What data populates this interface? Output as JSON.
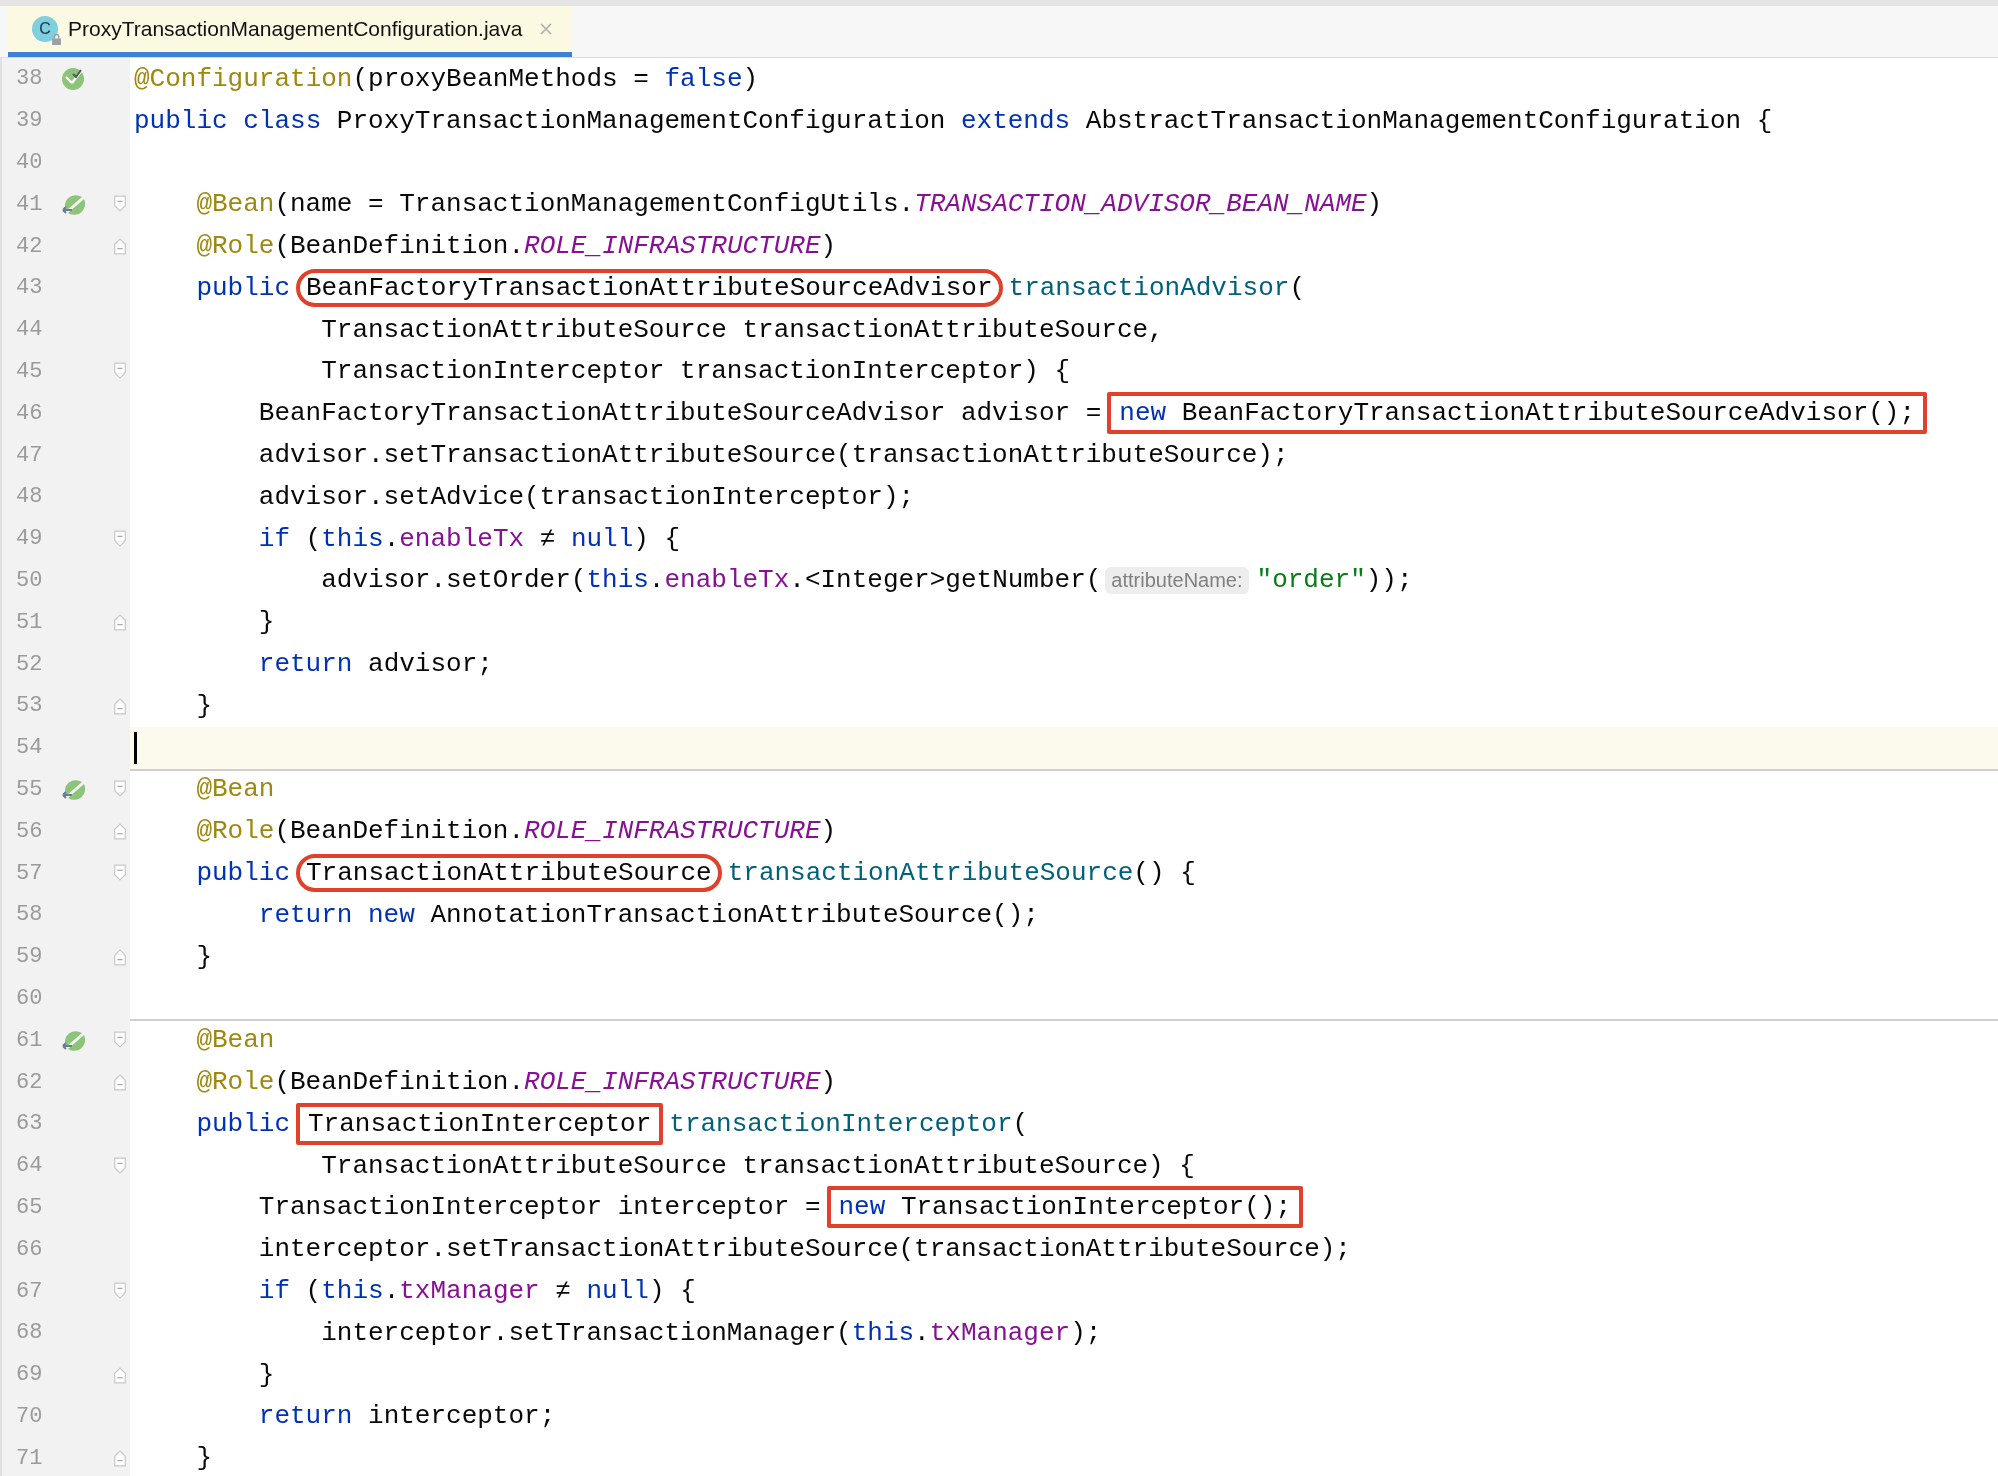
{
  "tab": {
    "icon_letter": "C",
    "title": "ProxyTransactionManagementConfiguration.java",
    "selected": true
  },
  "lines": [
    {
      "number": "38",
      "kind": "code",
      "gutter_icon": {
        "kind": "config"
      },
      "tokens": [
        {
          "text": "@Configuration",
          "kind": "annotation"
        },
        {
          "text": "(proxyBeanMethods = ",
          "kind": "plain"
        },
        {
          "text": "false",
          "kind": "keyword"
        },
        {
          "text": ")",
          "kind": "plain"
        }
      ]
    },
    {
      "number": "39",
      "kind": "code",
      "tokens": [
        {
          "text": "public class",
          "kind": "keyword"
        },
        {
          "text": " ProxyTransactionManagementConfiguration ",
          "kind": "plain"
        },
        {
          "text": "extends",
          "kind": "keyword"
        },
        {
          "text": " AbstractTransactionManagementConfiguration {",
          "kind": "plain"
        }
      ],
      "children": [
        {
          "number": "40",
          "kind": "blank"
        },
        {
          "number": "41",
          "kind": "code",
          "gutter_icon": {
            "kind": "bean"
          },
          "fold_marker": {
            "kind": "start"
          },
          "tokens": [
            {
              "text": "@Bean",
              "kind": "annotation"
            },
            {
              "text": "(name = TransactionManagementConfigUtils.",
              "kind": "plain"
            },
            {
              "text": "TRANSACTION_ADVISOR_BEAN_NAME",
              "kind": "constant"
            },
            {
              "text": ")",
              "kind": "plain"
            }
          ]
        },
        {
          "number": "42",
          "kind": "code",
          "fold_marker": {
            "kind": "end"
          },
          "tokens": [
            {
              "text": "@Role",
              "kind": "annotation"
            },
            {
              "text": "(BeanDefinition.",
              "kind": "plain"
            },
            {
              "text": "ROLE_INFRASTRUCTURE",
              "kind": "constant"
            },
            {
              "text": ")",
              "kind": "plain"
            }
          ]
        },
        {
          "number": "43",
          "kind": "code",
          "tokens": [
            {
              "text": "public",
              "kind": "keyword"
            },
            {
              "kind": "oval-box",
              "tokens": [
                {
                  "text": "BeanFactoryTransactionAttributeSourceAdvisor",
                  "kind": "plain"
                }
              ]
            },
            {
              "text": "transactionAdvisor",
              "kind": "method"
            },
            {
              "text": "(",
              "kind": "plain"
            }
          ],
          "children": [
            {
              "number": "44",
              "kind": "continuation",
              "tokens": [
                {
                  "text": "TransactionAttributeSource transactionAttributeSource,",
                  "kind": "plain"
                }
              ]
            },
            {
              "number": "45",
              "kind": "continuation",
              "fold_marker": {
                "kind": "start"
              },
              "tokens": [
                {
                  "text": "TransactionInterceptor transactionInterceptor) {",
                  "kind": "plain"
                }
              ]
            },
            {
              "number": "46",
              "kind": "code",
              "tokens": [
                {
                  "text": "BeanFactoryTransactionAttributeSourceAdvisor advisor =",
                  "kind": "plain"
                },
                {
                  "kind": "rect-box",
                  "tokens": [
                    {
                      "text": "new",
                      "kind": "keyword"
                    },
                    {
                      "text": " BeanFactoryTransactionAttributeSourceAdvisor();",
                      "kind": "plain"
                    }
                  ]
                }
              ]
            },
            {
              "number": "47",
              "kind": "code",
              "tokens": [
                {
                  "text": "advisor.setTransactionAttributeSource(transactionAttributeSource);",
                  "kind": "plain"
                }
              ]
            },
            {
              "number": "48",
              "kind": "code",
              "tokens": [
                {
                  "text": "advisor.setAdvice(transactionInterceptor);",
                  "kind": "plain"
                }
              ]
            },
            {
              "number": "49",
              "kind": "code",
              "fold_marker": {
                "kind": "start"
              },
              "tokens": [
                {
                  "text": "if",
                  "kind": "keyword"
                },
                {
                  "text": " (",
                  "kind": "plain"
                },
                {
                  "text": "this",
                  "kind": "keyword"
                },
                {
                  "text": ".",
                  "kind": "plain"
                },
                {
                  "text": "enableTx",
                  "kind": "field"
                },
                {
                  "text": " ≠ ",
                  "kind": "plain"
                },
                {
                  "text": "null",
                  "kind": "keyword"
                },
                {
                  "text": ") {",
                  "kind": "plain"
                }
              ],
              "children": [
                {
                  "number": "50",
                  "kind": "code",
                  "tokens": [
                    {
                      "text": "advisor.setOrder(",
                      "kind": "plain"
                    },
                    {
                      "text": "this",
                      "kind": "keyword"
                    },
                    {
                      "text": ".",
                      "kind": "plain"
                    },
                    {
                      "text": "enableTx",
                      "kind": "field"
                    },
                    {
                      "text": ".<Integer>getNumber(",
                      "kind": "plain"
                    },
                    {
                      "text": "attributeName:",
                      "kind": "hint"
                    },
                    {
                      "text": "\"order\"",
                      "kind": "string"
                    },
                    {
                      "text": "));",
                      "kind": "plain"
                    }
                  ]
                }
              ]
            },
            {
              "number": "51",
              "kind": "code",
              "fold_marker": {
                "kind": "end"
              },
              "tokens": [
                {
                  "text": "}",
                  "kind": "plain"
                }
              ]
            },
            {
              "number": "52",
              "kind": "code",
              "tokens": [
                {
                  "text": "return",
                  "kind": "keyword"
                },
                {
                  "text": " advisor;",
                  "kind": "plain"
                }
              ]
            }
          ]
        },
        {
          "number": "53",
          "kind": "code",
          "fold_marker": {
            "kind": "end"
          },
          "tokens": [
            {
              "text": "}",
              "kind": "plain"
            }
          ]
        },
        {
          "number": "54",
          "kind": "blank",
          "current": true
        },
        {
          "number": "55",
          "kind": "code",
          "separator_above": true,
          "gutter_icon": {
            "kind": "bean"
          },
          "fold_marker": {
            "kind": "start"
          },
          "tokens": [
            {
              "text": "@Bean",
              "kind": "annotation"
            }
          ]
        },
        {
          "number": "56",
          "kind": "code",
          "fold_marker": {
            "kind": "end"
          },
          "tokens": [
            {
              "text": "@Role",
              "kind": "annotation"
            },
            {
              "text": "(BeanDefinition.",
              "kind": "plain"
            },
            {
              "text": "ROLE_INFRASTRUCTURE",
              "kind": "constant"
            },
            {
              "text": ")",
              "kind": "plain"
            }
          ]
        },
        {
          "number": "57",
          "kind": "code",
          "fold_marker": {
            "kind": "start"
          },
          "tokens": [
            {
              "text": "public",
              "kind": "keyword"
            },
            {
              "kind": "oval-box",
              "tokens": [
                {
                  "text": "TransactionAttributeSource",
                  "kind": "plain"
                }
              ]
            },
            {
              "text": "transactionAttributeSource",
              "kind": "method"
            },
            {
              "text": "() {",
              "kind": "plain"
            }
          ],
          "children": [
            {
              "number": "58",
              "kind": "code",
              "tokens": [
                {
                  "text": "return new",
                  "kind": "keyword"
                },
                {
                  "text": " AnnotationTransactionAttributeSource();",
                  "kind": "plain"
                }
              ]
            }
          ]
        },
        {
          "number": "59",
          "kind": "code",
          "fold_marker": {
            "kind": "end"
          },
          "tokens": [
            {
              "text": "}",
              "kind": "plain"
            }
          ]
        },
        {
          "number": "60",
          "kind": "blank"
        },
        {
          "number": "61",
          "kind": "code",
          "separator_above": true,
          "gutter_icon": {
            "kind": "bean"
          },
          "fold_marker": {
            "kind": "start"
          },
          "tokens": [
            {
              "text": "@Bean",
              "kind": "annotation"
            }
          ]
        },
        {
          "number": "62",
          "kind": "code",
          "fold_marker": {
            "kind": "end"
          },
          "tokens": [
            {
              "text": "@Role",
              "kind": "annotation"
            },
            {
              "text": "(BeanDefinition.",
              "kind": "plain"
            },
            {
              "text": "ROLE_INFRASTRUCTURE",
              "kind": "constant"
            },
            {
              "text": ")",
              "kind": "plain"
            }
          ]
        },
        {
          "number": "63",
          "kind": "code",
          "tokens": [
            {
              "text": "public",
              "kind": "keyword"
            },
            {
              "kind": "rect-box",
              "tokens": [
                {
                  "text": "TransactionInterceptor",
                  "kind": "plain"
                }
              ]
            },
            {
              "text": "transactionInterceptor",
              "kind": "method"
            },
            {
              "text": "(",
              "kind": "plain"
            }
          ],
          "children": [
            {
              "number": "64",
              "kind": "continuation",
              "fold_marker": {
                "kind": "start"
              },
              "tokens": [
                {
                  "text": "TransactionAttributeSource transactionAttributeSource) {",
                  "kind": "plain"
                }
              ]
            },
            {
              "number": "65",
              "kind": "code",
              "tokens": [
                {
                  "text": "TransactionInterceptor interceptor =",
                  "kind": "plain"
                },
                {
                  "kind": "rect-box",
                  "tokens": [
                    {
                      "text": "new",
                      "kind": "keyword"
                    },
                    {
                      "text": " TransactionInterceptor();",
                      "kind": "plain"
                    }
                  ]
                }
              ]
            },
            {
              "number": "66",
              "kind": "code",
              "tokens": [
                {
                  "text": "interceptor.setTransactionAttributeSource(transactionAttributeSource);",
                  "kind": "plain"
                }
              ]
            },
            {
              "number": "67",
              "kind": "code",
              "fold_marker": {
                "kind": "start"
              },
              "tokens": [
                {
                  "text": "if",
                  "kind": "keyword"
                },
                {
                  "text": " (",
                  "kind": "plain"
                },
                {
                  "text": "this",
                  "kind": "keyword"
                },
                {
                  "text": ".",
                  "kind": "plain"
                },
                {
                  "text": "txManager",
                  "kind": "field"
                },
                {
                  "text": " ≠ ",
                  "kind": "plain"
                },
                {
                  "text": "null",
                  "kind": "keyword"
                },
                {
                  "text": ") {",
                  "kind": "plain"
                }
              ],
              "children": [
                {
                  "number": "68",
                  "kind": "code",
                  "tokens": [
                    {
                      "text": "interceptor.setTransactionManager(",
                      "kind": "plain"
                    },
                    {
                      "text": "this",
                      "kind": "keyword"
                    },
                    {
                      "text": ".",
                      "kind": "plain"
                    },
                    {
                      "text": "txManager",
                      "kind": "field"
                    },
                    {
                      "text": ");",
                      "kind": "plain"
                    }
                  ]
                }
              ]
            },
            {
              "number": "69",
              "kind": "code",
              "fold_marker": {
                "kind": "end"
              },
              "tokens": [
                {
                  "text": "}",
                  "kind": "plain"
                }
              ]
            },
            {
              "number": "70",
              "kind": "code",
              "tokens": [
                {
                  "text": "return",
                  "kind": "keyword"
                },
                {
                  "text": " interceptor;",
                  "kind": "plain"
                }
              ]
            }
          ]
        },
        {
          "number": "71",
          "kind": "code",
          "fold_marker": {
            "kind": "end"
          },
          "tokens": [
            {
              "text": "}",
              "kind": "plain"
            }
          ]
        }
      ]
    }
  ]
}
